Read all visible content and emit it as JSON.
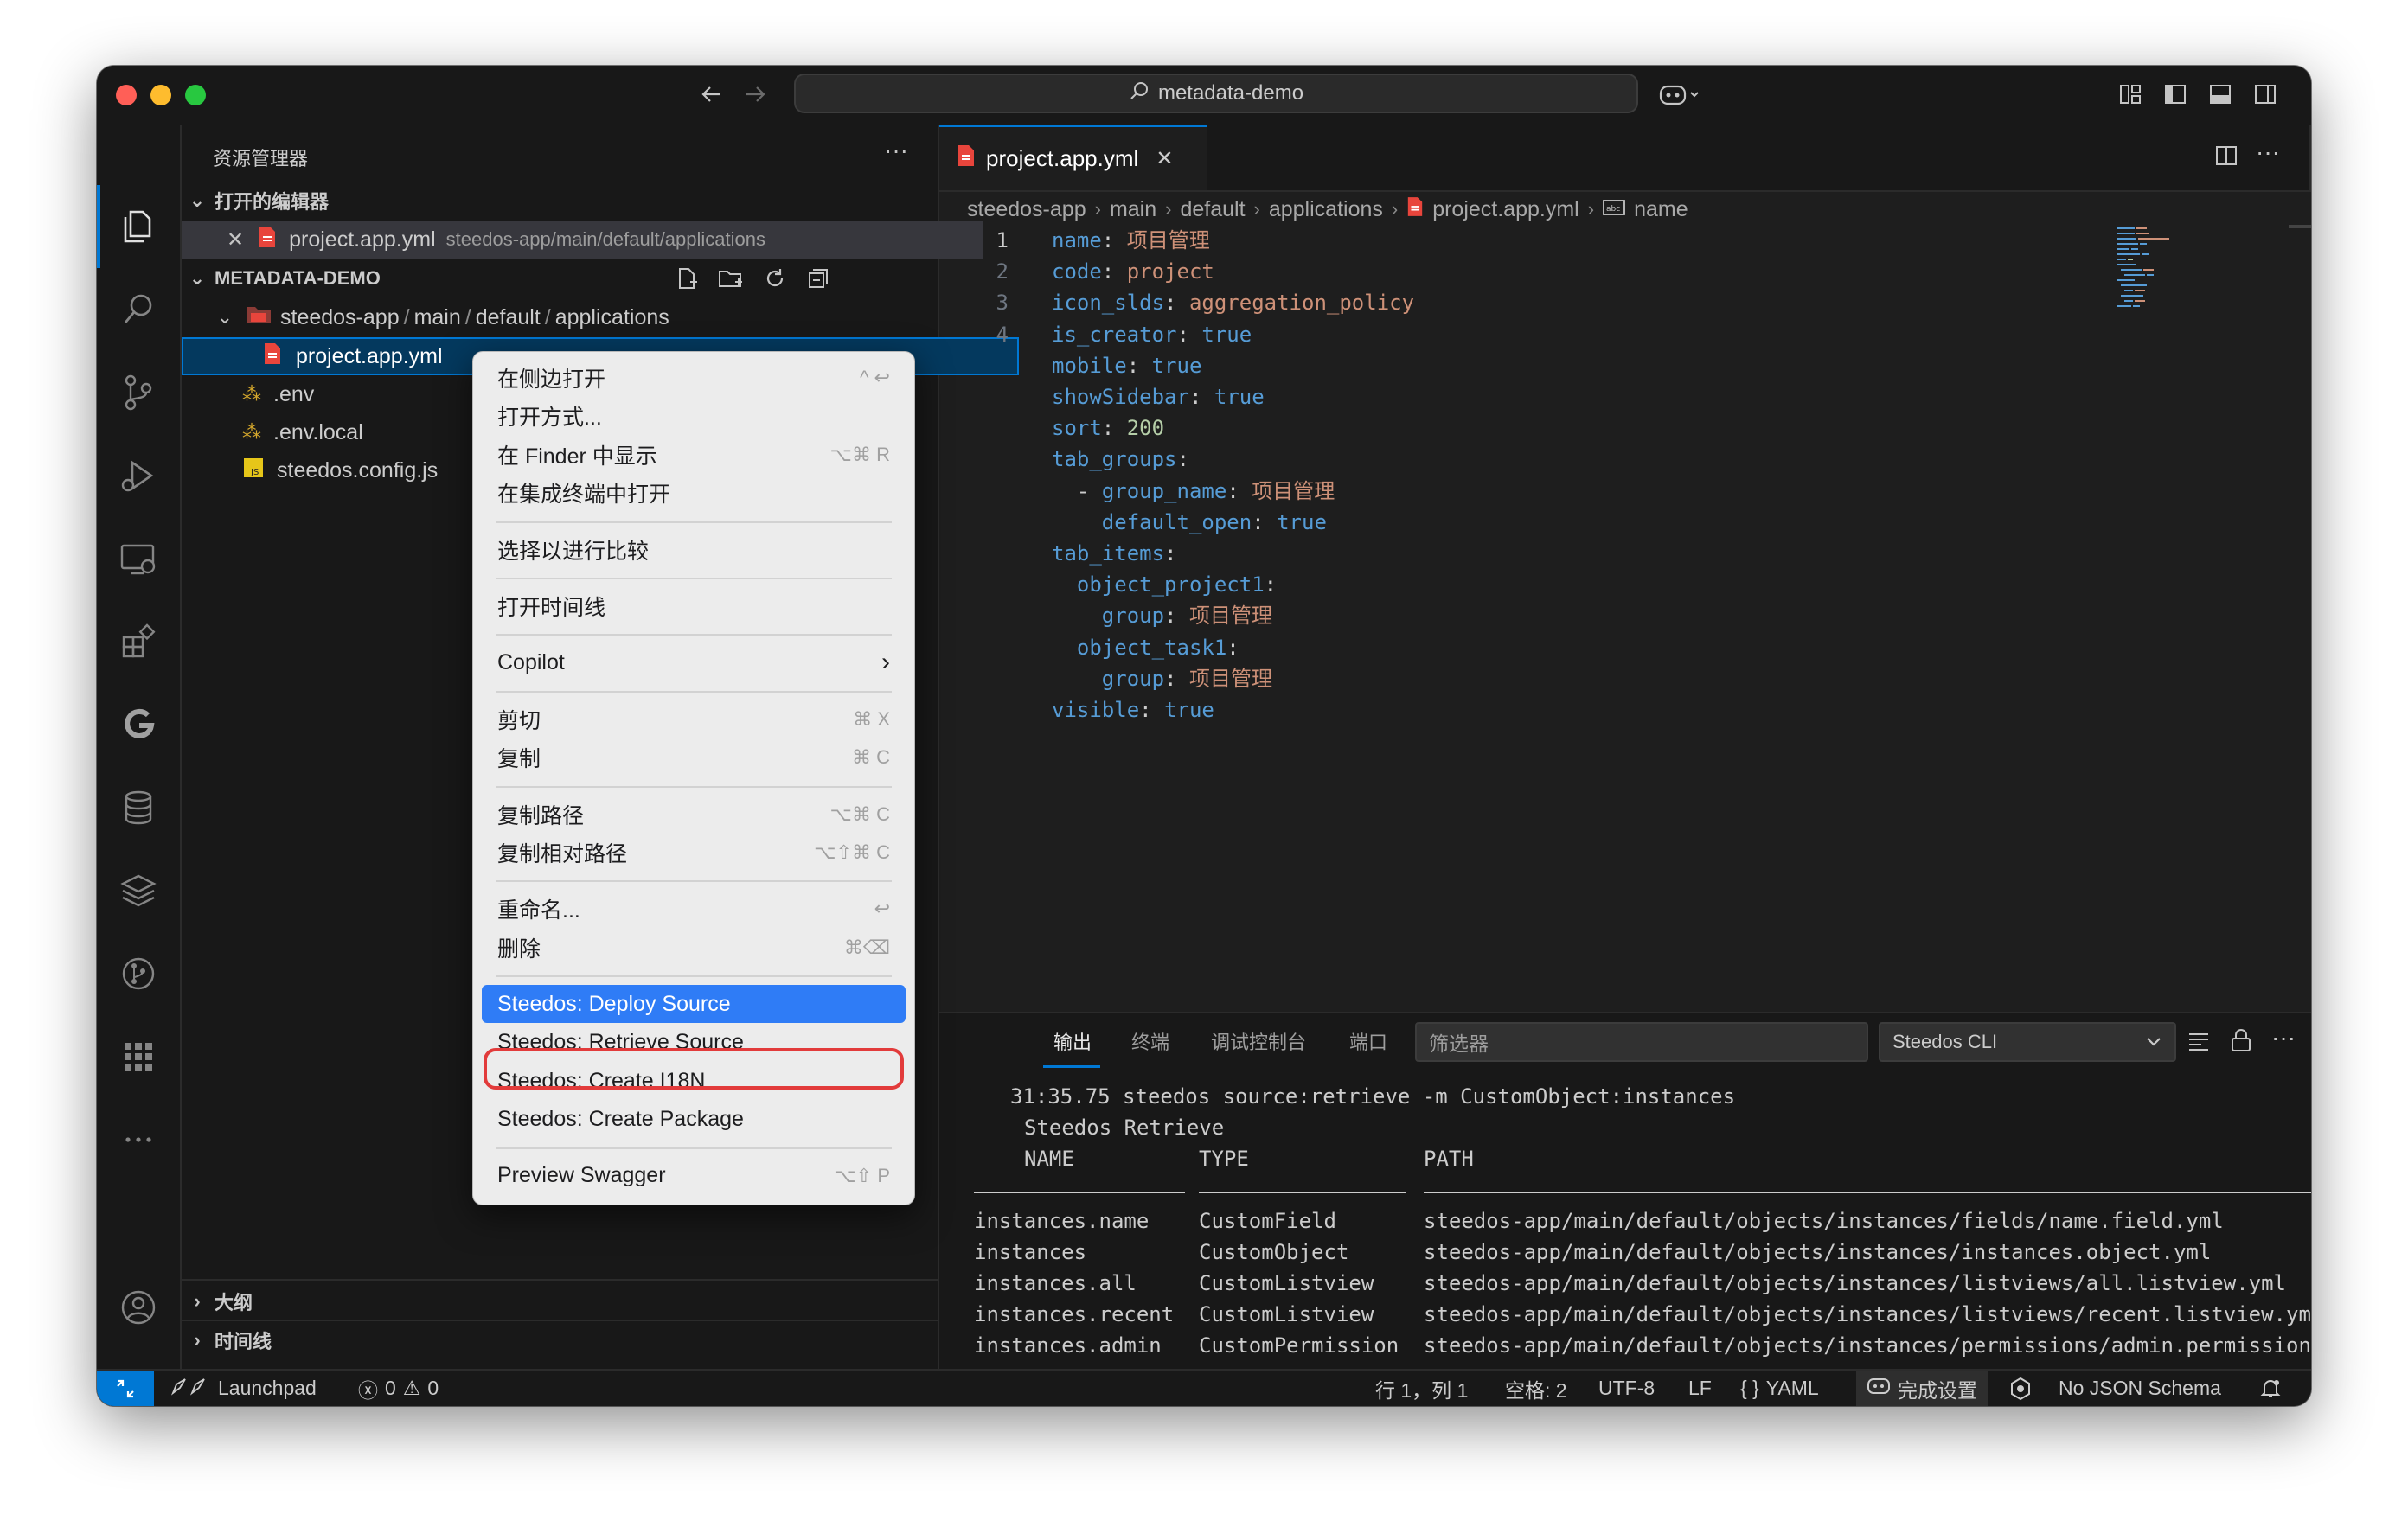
{
  "window": {
    "search_text": "metadata-demo"
  },
  "sidebar": {
    "title": "资源管理器",
    "more": "···",
    "open_editors": {
      "header": "打开的编辑器",
      "items": [
        {
          "name": "project.app.yml",
          "path": "steedos-app/main/default/applications"
        }
      ]
    },
    "workspace": {
      "header": "METADATA-DEMO",
      "folder": [
        "steedos-app",
        "main",
        "default",
        "applications"
      ],
      "files": [
        {
          "name": "project.app.yml",
          "icon": "yaml-file-icon"
        },
        {
          "name": ".env",
          "icon": "env-file-icon"
        },
        {
          "name": ".env.local",
          "icon": "env-file-icon"
        },
        {
          "name": "steedos.config.js",
          "icon": "js-file-icon"
        }
      ]
    },
    "outline": "大纲",
    "timeline": "时间线"
  },
  "editor": {
    "tab_label": "project.app.yml",
    "breadcrumb": [
      "steedos-app",
      "main",
      "default",
      "applications",
      "project.app.yml",
      "name"
    ],
    "lines": [
      {
        "num": "1",
        "indent": "",
        "dash": "",
        "key": "name",
        "value": "项目管理",
        "type": "str"
      },
      {
        "num": "2",
        "indent": "",
        "dash": "",
        "key": "code",
        "value": "project",
        "type": "str"
      },
      {
        "num": "3",
        "indent": "",
        "dash": "",
        "key": "icon_slds",
        "value": "aggregation_policy",
        "type": "str"
      },
      {
        "num": "4",
        "indent": "",
        "dash": "",
        "key": "is_creator",
        "value": "true",
        "type": "bool"
      },
      {
        "num": "",
        "indent": "",
        "dash": "",
        "key": "mobile",
        "value": "true",
        "type": "bool"
      },
      {
        "num": "",
        "indent": "",
        "dash": "",
        "key": "showSidebar",
        "value": "true",
        "type": "bool"
      },
      {
        "num": "",
        "indent": "",
        "dash": "",
        "key": "sort",
        "value": "200",
        "type": "num"
      },
      {
        "num": "",
        "indent": "",
        "dash": "",
        "key": "tab_groups",
        "value": "",
        "type": "none"
      },
      {
        "num": "",
        "indent": "  ",
        "dash": "- ",
        "key": "group_name",
        "value": "项目管理",
        "type": "str"
      },
      {
        "num": "",
        "indent": "    ",
        "dash": "",
        "key": "default_open",
        "value": "true",
        "type": "bool"
      },
      {
        "num": "",
        "indent": "",
        "dash": "",
        "key": "tab_items",
        "value": "",
        "type": "none"
      },
      {
        "num": "",
        "indent": "  ",
        "dash": "",
        "key": "object_project1",
        "value": "",
        "type": "none"
      },
      {
        "num": "",
        "indent": "    ",
        "dash": "",
        "key": "group",
        "value": "项目管理",
        "type": "str"
      },
      {
        "num": "",
        "indent": "  ",
        "dash": "",
        "key": "object_task1",
        "value": "",
        "type": "none"
      },
      {
        "num": "",
        "indent": "    ",
        "dash": "",
        "key": "group",
        "value": "项目管理",
        "type": "str"
      },
      {
        "num": "",
        "indent": "",
        "dash": "",
        "key": "visible",
        "value": "true",
        "type": "bool"
      }
    ]
  },
  "context_menu": {
    "items": [
      {
        "label": "在侧边打开",
        "shortcut": "^ ↩"
      },
      {
        "label": "打开方式...",
        "shortcut": ""
      },
      {
        "label": "在 Finder 中显示",
        "shortcut": "⌥⌘ R"
      },
      {
        "label": "在集成终端中打开",
        "shortcut": ""
      },
      {
        "sep": true
      },
      {
        "label": "选择以进行比较",
        "shortcut": ""
      },
      {
        "sep": true
      },
      {
        "label": "打开时间线",
        "shortcut": ""
      },
      {
        "sep": true
      },
      {
        "label": "Copilot",
        "shortcut": "›"
      },
      {
        "sep": true
      },
      {
        "label": "剪切",
        "shortcut": "⌘ X"
      },
      {
        "label": "复制",
        "shortcut": "⌘ C"
      },
      {
        "sep": true
      },
      {
        "label": "复制路径",
        "shortcut": "⌥⌘ C"
      },
      {
        "label": "复制相对路径",
        "shortcut": "⌥⇧⌘ C"
      },
      {
        "sep": true
      },
      {
        "label": "重命名...",
        "shortcut": "↩"
      },
      {
        "label": "删除",
        "shortcut": "⌘⌫"
      },
      {
        "sep": true
      },
      {
        "label": "Steedos: Deploy Source",
        "shortcut": "",
        "highlighted": true
      },
      {
        "label": "Steedos: Retrieve Source",
        "shortcut": ""
      },
      {
        "label": "Steedos: Create I18N",
        "shortcut": ""
      },
      {
        "label": "Steedos: Create Package",
        "shortcut": ""
      },
      {
        "sep": true
      },
      {
        "label": "Preview Swagger",
        "shortcut": "⌥⇧ P"
      }
    ]
  },
  "panel": {
    "tabs": [
      "输出",
      "终端",
      "调试控制台",
      "端口"
    ],
    "active_tab": "输出",
    "filter_placeholder": "筛选器",
    "channel": "Steedos CLI",
    "output_lines": [
      "31:35.75 steedos source:retrieve -m CustomObject:instances",
      "Steedos Retrieve"
    ],
    "table": {
      "headers": [
        "NAME",
        "TYPE",
        "PATH"
      ],
      "rows": [
        [
          "instances.name",
          "CustomField",
          "steedos-app/main/default/objects/instances/fields/name.field.yml"
        ],
        [
          "instances",
          "CustomObject",
          "steedos-app/main/default/objects/instances/instances.object.yml"
        ],
        [
          "instances.all",
          "CustomListview",
          "steedos-app/main/default/objects/instances/listviews/all.listview.yml"
        ],
        [
          "instances.recent",
          "CustomListview",
          "steedos-app/main/default/objects/instances/listviews/recent.listview.yml"
        ],
        [
          "instances.admin",
          "CustomPermission",
          "steedos-app/main/default/objects/instances/permissions/admin.permission.yml"
        ]
      ]
    }
  },
  "statusbar": {
    "launchpad": "Launchpad",
    "errors": "0",
    "warnings": "0",
    "position": "行 1，列 1",
    "spaces": "空格: 2",
    "encoding": "UTF-8",
    "eol": "LF",
    "language": "YAML",
    "copilot": "完成设置",
    "schema": "No JSON Schema"
  },
  "colors": {
    "accent": "#0078d4",
    "menu_highlight": "#2f7cf6",
    "highlight_outline": "#e23b3b",
    "yaml_key": "#569cd6",
    "yaml_string": "#ce9178",
    "yaml_number": "#b5cea8"
  }
}
